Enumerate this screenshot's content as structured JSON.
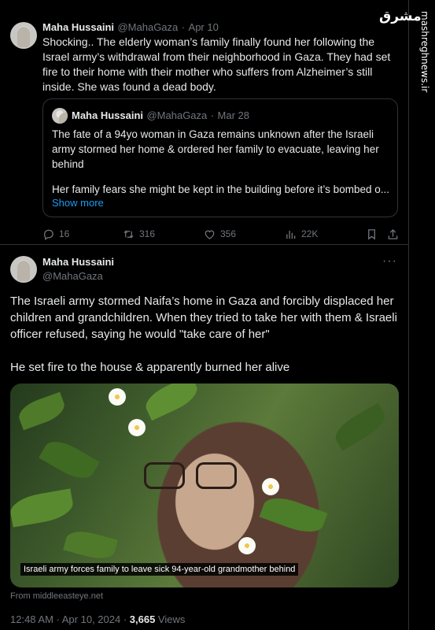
{
  "watermark": {
    "logo_text": "مشرق",
    "site": "mashreghnews.ir"
  },
  "tweet1": {
    "author_name": "Maha Hussaini",
    "author_handle": "@MahaGaza",
    "separator": "·",
    "date": "Apr 10",
    "text": "Shocking.. The elderly woman’s family finally found her following the Israel army’s withdrawal from their neighborhood in Gaza. They had set fire to their home with their mother who suffers from Alzheimer’s still inside. She was found a dead body.",
    "quote": {
      "author_name": "Maha Hussaini",
      "author_handle": "@MahaGaza",
      "separator": "·",
      "date": "Mar 28",
      "paragraph1": "The fate of a 94yo woman in Gaza remains unknown after the Israeli army stormed her home & ordered her family to evacuate, leaving her behind",
      "paragraph2": "Her family fears she might be kept in the building before it’s bombed o...",
      "show_more": "Show more"
    },
    "actions": {
      "replies": "16",
      "reposts": "316",
      "likes": "356",
      "views": "22K"
    },
    "icons": [
      "reply-icon",
      "repost-icon",
      "like-icon",
      "views-icon",
      "bookmark-icon",
      "share-icon"
    ]
  },
  "tweet2": {
    "author_name": "Maha Hussaini",
    "author_handle": "@MahaGaza",
    "more_label": "···",
    "text_p1": "The Israeli army stormed Naifa’s home in Gaza and forcibly displaced her children and grandchildren. When they tried to take her with them & Israeli officer refused, saying he would \"take care of her\"",
    "text_p2": "He set fire to the house & apparently burned her alive",
    "media_caption": "Israeli army forces family to leave sick 94-year-old grandmother behind",
    "source": "From middleeasteye.net",
    "time": "12:48 AM · Apr 10, 2024 · ",
    "views_count": "3,665",
    "views_label": " Views"
  }
}
